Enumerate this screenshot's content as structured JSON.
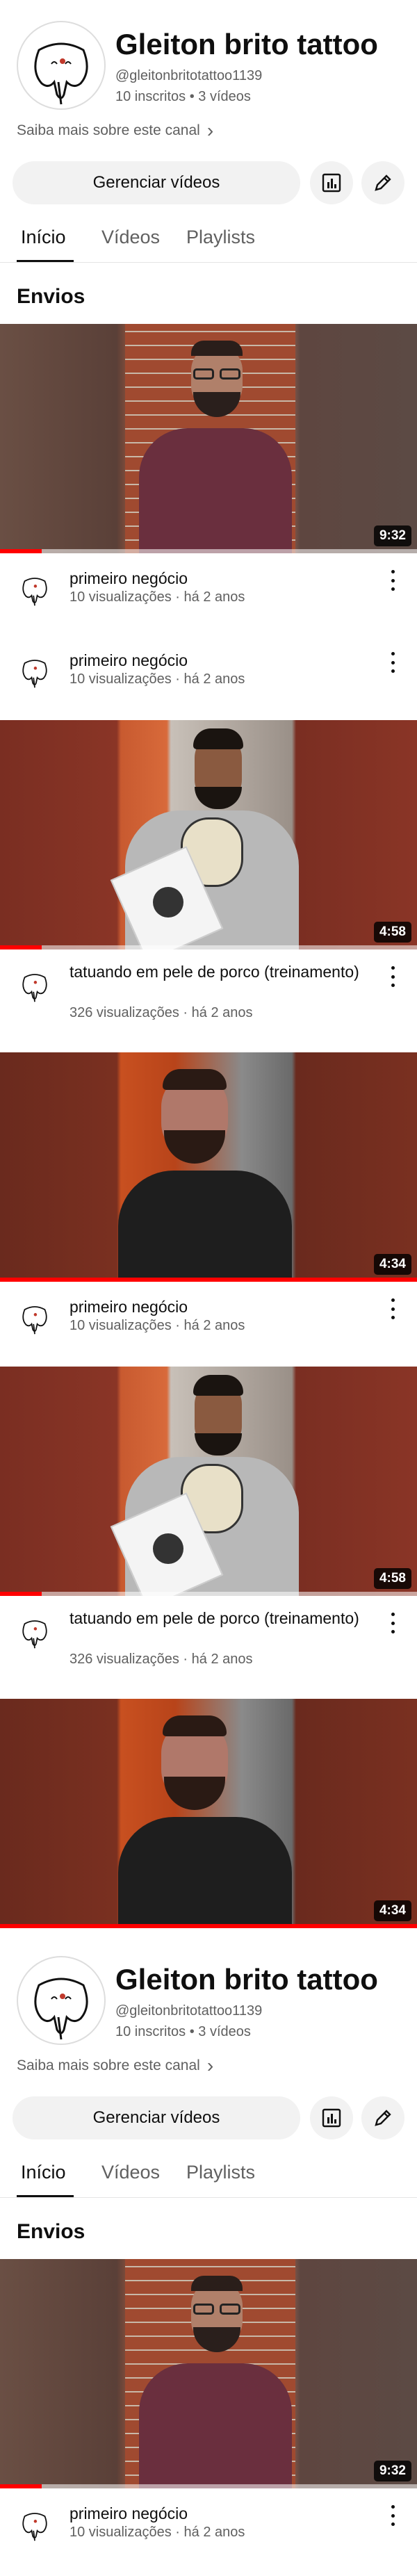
{
  "channel": {
    "name": "Gleiton brito tattoo",
    "handle": "@gleitonbritotattoo1139",
    "stats": "10 inscritos • 3 vídeos",
    "about": "Saiba mais sobre este canal",
    "about_chevron": "›"
  },
  "actions": {
    "manage_label": "Gerenciar vídeos",
    "analytics_icon": "bar-chart-icon",
    "edit_icon": "pencil-icon"
  },
  "tabs": [
    {
      "label": "Início"
    },
    {
      "label": "Vídeos"
    },
    {
      "label": "Playlists"
    }
  ],
  "section_title": "Envios",
  "videos": [
    {
      "title": "primeiro negócio",
      "sub": "10 visualizações · há 2 anos",
      "duration": "9:32",
      "watched": 0.1
    },
    {
      "title": "primeiro negócio",
      "sub": "10 visualizações · há 2 anos",
      "duration": "",
      "watched": 0
    },
    {
      "title": "tatuando em pele de porco (treinamento)",
      "sub": "326 visualizações · há 2 anos",
      "duration": "4:58",
      "watched": 0.1
    },
    {
      "title": "primeiro negócio",
      "sub": "10 visualizações · há 2 anos",
      "duration": "4:34",
      "watched": 1.0
    },
    {
      "title": "tatuando em pele de porco (treinamento)",
      "sub": "326 visualizações · há 2 anos",
      "duration": "4:58",
      "watched": 0.1
    },
    {
      "title": "",
      "sub": "",
      "duration": "4:34",
      "watched": 1.0
    }
  ],
  "colors": {
    "accent": "#ff0000",
    "muted": "#606060",
    "chip_bg": "#f2f2f2"
  }
}
